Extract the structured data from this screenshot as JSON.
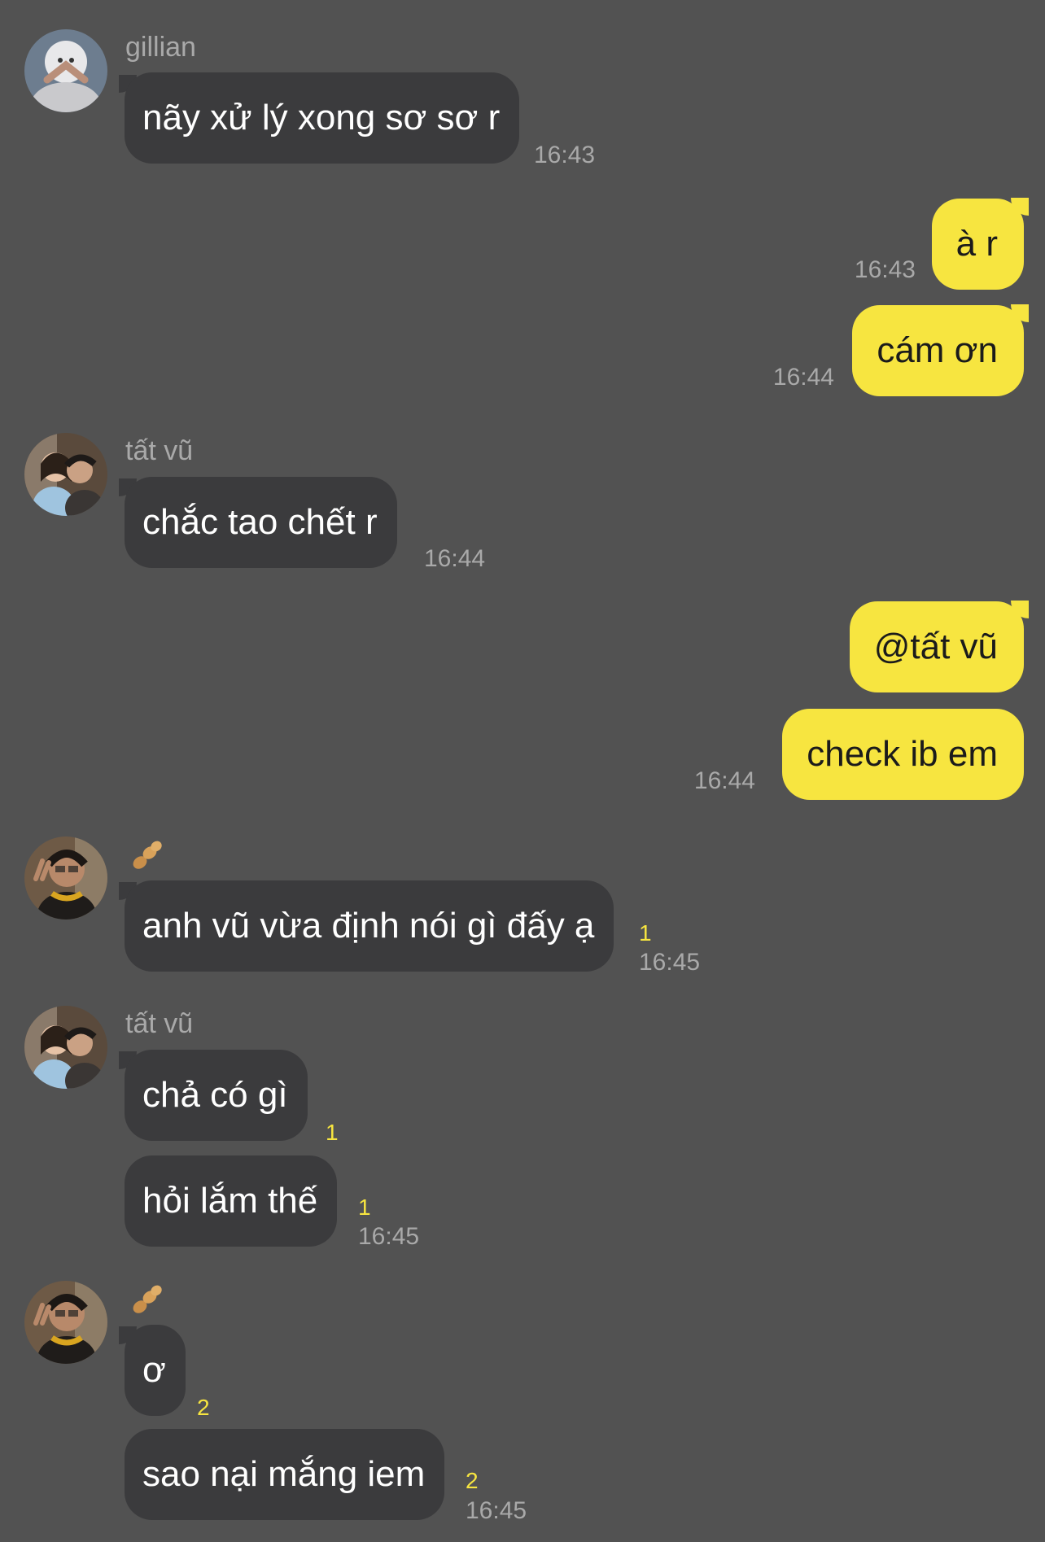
{
  "colors": {
    "background": "#525252",
    "incoming_bubble": "#3b3b3d",
    "outgoing_bubble": "#f7e540",
    "meta_text": "#a9a9a9",
    "unread_count": "#f7e540"
  },
  "messages": {
    "m1": {
      "sender": "gillian",
      "text": "nãy xử lý xong sơ sơ r",
      "time": "16:43"
    },
    "m2": {
      "text": "à r",
      "time": "16:43"
    },
    "m3": {
      "text": "cám ơn",
      "time": "16:44"
    },
    "m4": {
      "sender": "tất vũ",
      "text": "chắc tao chết r",
      "time": "16:44"
    },
    "m5": {
      "text": "@tất vũ"
    },
    "m6": {
      "text": "check ib em",
      "time": "16:44"
    },
    "m7": {
      "sender_icon": "peanut-emoji-icon",
      "text": "anh vũ vừa định nói gì đấy ạ",
      "unread": "1",
      "time": "16:45"
    },
    "m8": {
      "sender": "tất vũ",
      "text": "chả có gì",
      "unread": "1"
    },
    "m9": {
      "text": "hỏi lắm thế",
      "unread": "1",
      "time": "16:45"
    },
    "m10": {
      "sender_icon": "peanut-emoji-icon",
      "text": "ơ",
      "unread": "2"
    },
    "m11": {
      "text": "sao nại mắng iem",
      "unread": "2",
      "time": "16:45"
    }
  }
}
